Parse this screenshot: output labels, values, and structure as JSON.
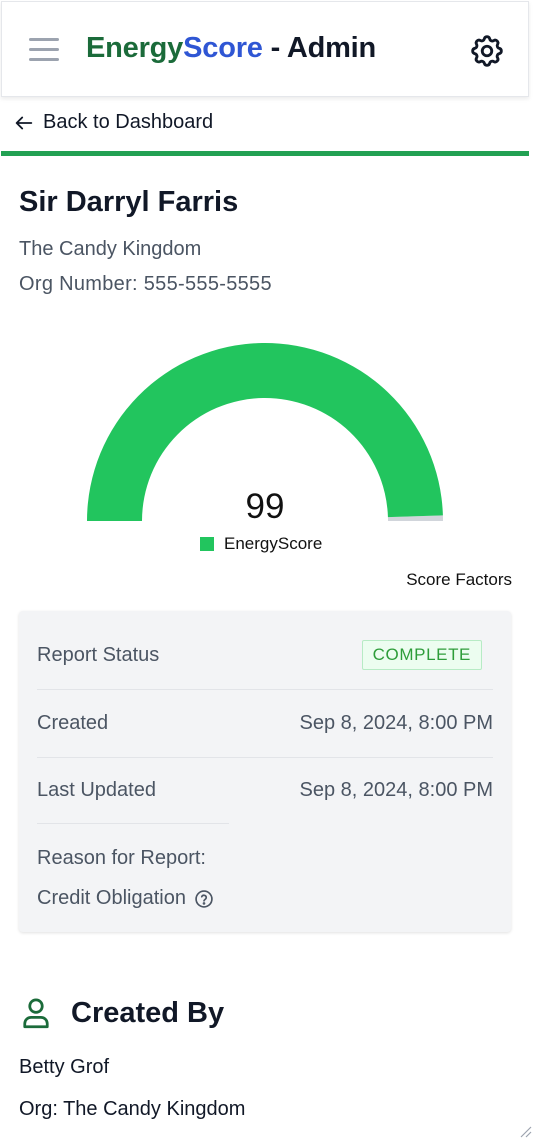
{
  "header": {
    "brand_part1": "Energy",
    "brand_part2": "Score",
    "brand_suffix": " - Admin",
    "menu_icon": "hamburger-menu-icon",
    "settings_icon": "gear-icon"
  },
  "nav": {
    "back_label": "Back to Dashboard"
  },
  "profile": {
    "name": "Sir Darryl Farris",
    "organization": "The Candy Kingdom",
    "org_number": "Org Number: 555-555-5555"
  },
  "chart_data": {
    "type": "gauge",
    "value": 99,
    "max": 100,
    "series": [
      {
        "name": "EnergyScore",
        "values": [
          99
        ]
      }
    ],
    "colors": {
      "fill": "#22c55e",
      "remainder": "#d1d5db"
    }
  },
  "score_factors_label": "Score Factors",
  "report": {
    "status_label": "Report Status",
    "status_value": "COMPLETE",
    "created_label": "Created",
    "created_value": "Sep 8, 2024, 8:00 PM",
    "updated_label": "Last Updated",
    "updated_value": "Sep 8, 2024, 8:00 PM",
    "reason_label": "Reason for Report:",
    "reason_value": "Credit Obligation",
    "reason_help_icon": "question-circle-icon"
  },
  "created_by": {
    "title": "Created By",
    "icon": "user-icon",
    "name": "Betty Grof",
    "org": "Org: The Candy Kingdom"
  },
  "colors": {
    "brand_green": "#1b6b3a",
    "brand_blue": "#2f56d4",
    "accent_green": "#22a153",
    "gauge_green": "#22c55e",
    "badge_text": "#2e9d3a"
  }
}
